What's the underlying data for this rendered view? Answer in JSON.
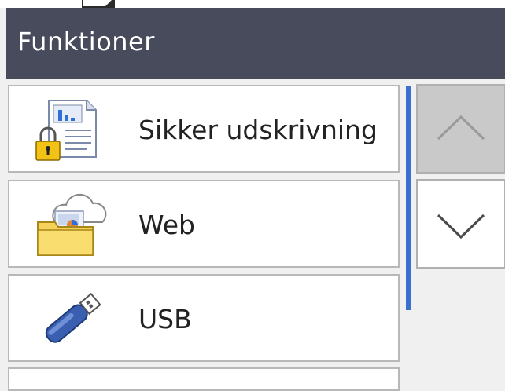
{
  "header": {
    "title": "Funktioner"
  },
  "menu": {
    "items": [
      {
        "label": "Sikker udskrivning",
        "icon": "secure-print-icon"
      },
      {
        "label": "Web",
        "icon": "web-cloud-folder-icon"
      },
      {
        "label": "USB",
        "icon": "usb-drive-icon"
      }
    ]
  },
  "navigation": {
    "up_icon": "chevron-up-icon",
    "down_icon": "chevron-down-icon"
  },
  "colors": {
    "header_bg": "#484b5c",
    "scroll_indicator": "#3a6fd0"
  }
}
